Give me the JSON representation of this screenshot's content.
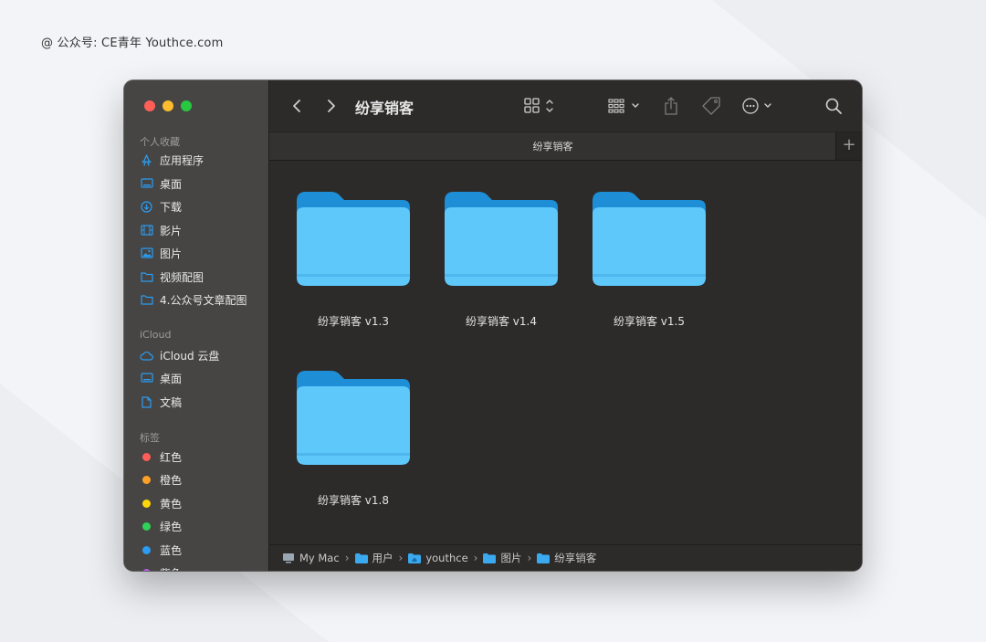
{
  "watermark": "@ 公众号: CE青年    Youthce.com",
  "window": {
    "title": "纷享销客",
    "tab_title": "纷享销客",
    "new_tab": "+"
  },
  "colors": {
    "close": "#ff5f57",
    "minimize": "#febc2e",
    "zoom": "#28c840",
    "accent": "#2b9cf2",
    "folder": "#5ec8fb"
  },
  "sidebar": {
    "favorites_heading": "个人收藏",
    "favorites": [
      {
        "label": "应用程序",
        "icon": "applications-icon"
      },
      {
        "label": "桌面",
        "icon": "desktop-icon"
      },
      {
        "label": "下载",
        "icon": "download-icon"
      },
      {
        "label": "影片",
        "icon": "film-icon"
      },
      {
        "label": "图片",
        "icon": "photo-icon"
      },
      {
        "label": "视频配图",
        "icon": "folder-icon"
      },
      {
        "label": "4.公众号文章配图",
        "icon": "folder-icon"
      }
    ],
    "icloud_heading": "iCloud",
    "icloud": [
      {
        "label": "iCloud 云盘",
        "icon": "cloud-icon"
      },
      {
        "label": "桌面",
        "icon": "desktop-icon"
      },
      {
        "label": "文稿",
        "icon": "document-icon"
      }
    ],
    "tags_heading": "标签",
    "tags": [
      {
        "label": "红色",
        "color": "#ff5e57"
      },
      {
        "label": "橙色",
        "color": "#ffa126"
      },
      {
        "label": "黄色",
        "color": "#ffd60a"
      },
      {
        "label": "绿色",
        "color": "#31d158"
      },
      {
        "label": "蓝色",
        "color": "#2b9cf2"
      },
      {
        "label": "紫色",
        "color": "#bf5af2"
      }
    ]
  },
  "files": [
    {
      "name": "纷享销客 v1.3"
    },
    {
      "name": "纷享销客 v1.4"
    },
    {
      "name": "纷享销客 v1.5"
    },
    {
      "name": "纷享销客 v1.8"
    }
  ],
  "pathbar": [
    {
      "label": "My Mac",
      "icon": "computer-icon"
    },
    {
      "label": "用户",
      "icon": "folder-icon"
    },
    {
      "label": "youthce",
      "icon": "home-folder-icon"
    },
    {
      "label": "图片",
      "icon": "folder-icon"
    },
    {
      "label": "纷享销客",
      "icon": "folder-icon"
    }
  ]
}
